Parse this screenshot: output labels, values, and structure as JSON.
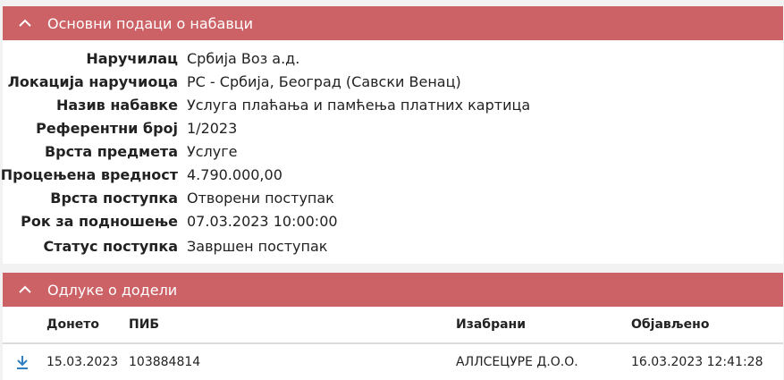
{
  "section_basic": {
    "title": "Основни подаци о набавци",
    "rows": [
      {
        "label": "Наручилац",
        "value": "Србија Воз а.д."
      },
      {
        "label": "Локација наручиоца",
        "value": "РС - Србија, Београд (Савски Венац)"
      },
      {
        "label": "Назив набавке",
        "value": "Услуга плаћања и памћења платних картица"
      },
      {
        "label": "Референтни број",
        "value": "1/2023"
      },
      {
        "label": "Врста предмета",
        "value": "Услуге"
      },
      {
        "label": "Процењена вредност",
        "value": "4.790.000,00"
      },
      {
        "label": "Врста поступка",
        "value": "Отворени поступак"
      },
      {
        "label": "Рок за подношење",
        "value": "07.03.2023 10:00:00"
      },
      {
        "label": "Статус поступка",
        "value": "Завршен поступак"
      }
    ]
  },
  "section_decisions": {
    "title": "Одлуке о додели",
    "columns": [
      "Донето",
      "ПИБ",
      "Изабрани",
      "Објављено"
    ],
    "rows": [
      {
        "donet": "15.03.2023",
        "pib": "103884814",
        "izabrani": "АЛЛСЕЦУРЕ Д.О.О.",
        "objavljeno": "16.03.2023 12:41:28"
      }
    ]
  },
  "icons": {
    "collapse": "chevron-up-icon",
    "download": "download-icon"
  },
  "colors": {
    "header_bg": "#cc6266",
    "download_icon": "#2f7fc1"
  }
}
